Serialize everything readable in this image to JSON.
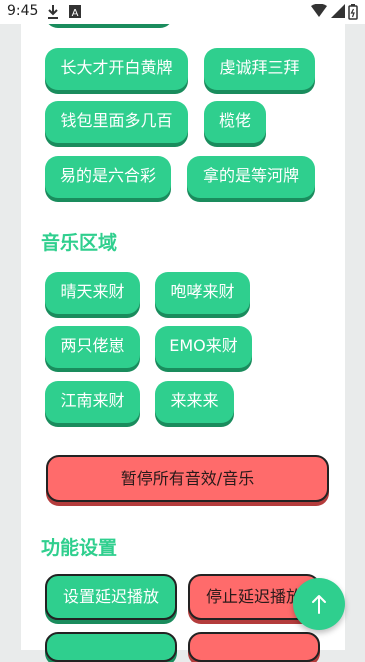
{
  "status": {
    "time": "9:45"
  },
  "topRows": [
    [
      "长大才开白黄牌",
      "虔诚拜三拜"
    ],
    [
      "钱包里面多几百",
      "榄佬"
    ],
    [
      "易的是六合彩",
      "拿的是等河牌"
    ]
  ],
  "music": {
    "title": "音乐区域",
    "items": [
      [
        "晴天来财",
        "咆哮来财"
      ],
      [
        "两只佬崽",
        "EMO来财"
      ],
      [
        "江南来财",
        "来来来"
      ]
    ]
  },
  "stop_all": "暂停所有音效/音乐",
  "settings": {
    "title": "功能设置",
    "set_delay": "设置延迟播放",
    "stop_delay": "停止延迟播放"
  },
  "fab_icon": "arrow-up-icon",
  "colors": {
    "accent": "#2fcf8e",
    "danger": "#ff6b6b"
  }
}
